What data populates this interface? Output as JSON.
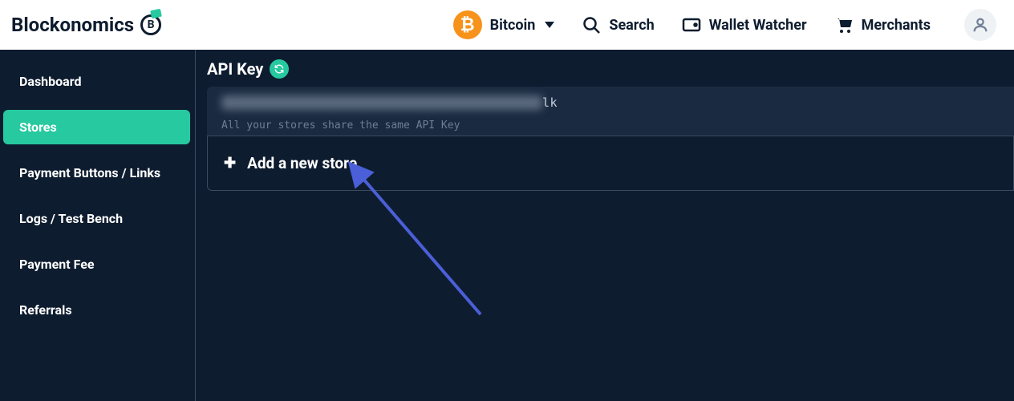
{
  "header": {
    "logo_text": "Blockonomics",
    "logo_letter": "B",
    "crypto_dropdown": {
      "label": "Bitcoin",
      "icon_symbol": "₿"
    },
    "nav": {
      "search": "Search",
      "wallet_watcher": "Wallet Watcher",
      "merchants": "Merchants"
    }
  },
  "sidebar": {
    "items": [
      {
        "label": "Dashboard",
        "active": false
      },
      {
        "label": "Stores",
        "active": true
      },
      {
        "label": "Payment Buttons / Links",
        "active": false
      },
      {
        "label": "Logs / Test Bench",
        "active": false
      },
      {
        "label": "Payment Fee",
        "active": false
      },
      {
        "label": "Referrals",
        "active": false
      }
    ]
  },
  "main": {
    "api_key_title": "API Key",
    "api_key_tail": "lk",
    "api_key_note": "All your stores share the same API Key",
    "add_store_label": "Add a new store"
  }
}
